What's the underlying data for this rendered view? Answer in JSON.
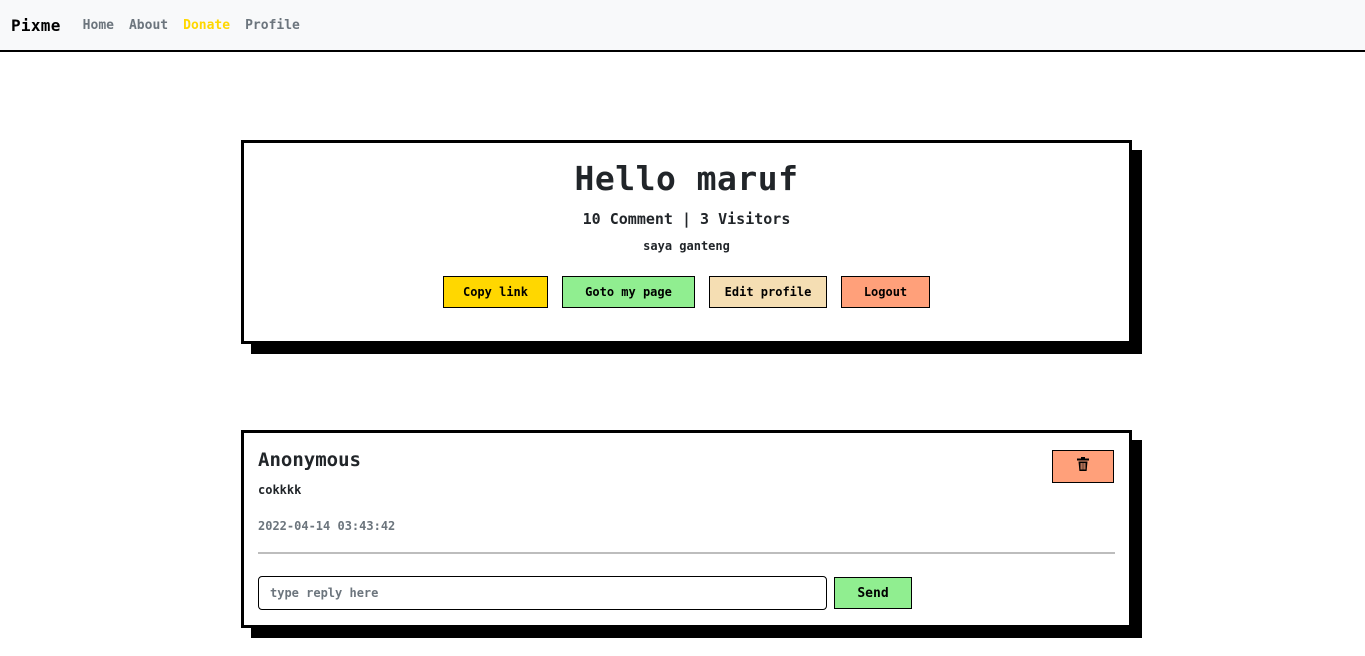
{
  "navbar": {
    "brand": "Pixme",
    "links": [
      {
        "label": "Home",
        "active": false
      },
      {
        "label": "About",
        "active": false
      },
      {
        "label": "Donate",
        "active": true
      },
      {
        "label": "Profile",
        "active": false
      }
    ]
  },
  "profile": {
    "greeting": "Hello maruf",
    "stats": "10 Comment | 3 Visitors",
    "bio": "saya ganteng",
    "buttons": {
      "copy_link": "Copy link",
      "goto_page": "Goto my page",
      "edit_profile": "Edit profile",
      "logout": "Logout"
    }
  },
  "comment": {
    "author": "Anonymous",
    "text": "cokkkk",
    "timestamp": "2022-04-14 03:43:42",
    "delete_icon": "trash-icon",
    "reply_placeholder": "type reply here",
    "send_label": "Send"
  },
  "colors": {
    "copy_link": "#ffd700",
    "goto_page": "#90ee90",
    "edit_profile": "#f5deb3",
    "logout": "#ffa07a",
    "delete": "#ffa07a",
    "send": "#90ee90",
    "nav_active": "#ffd700"
  }
}
